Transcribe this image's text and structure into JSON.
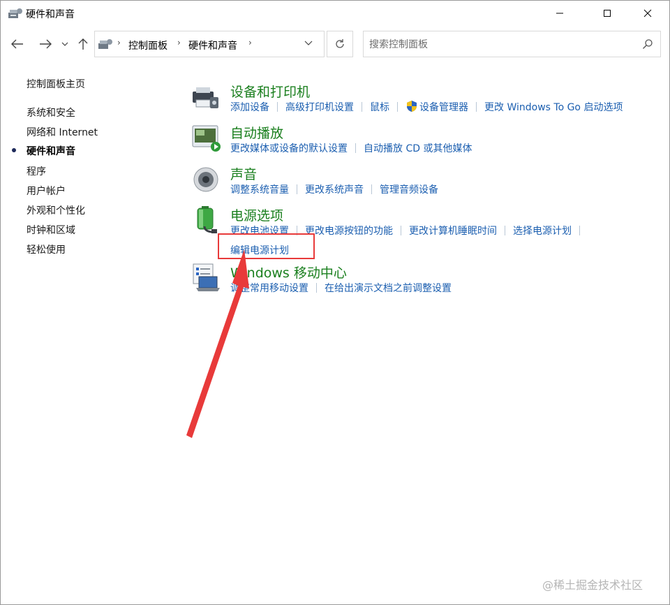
{
  "window": {
    "title": "硬件和声音",
    "buttons": {
      "minimize": "—",
      "maximize": "☐",
      "close": "✕"
    }
  },
  "nav": {
    "back": "←",
    "forward": "→",
    "recent": "⌄",
    "up": "↑",
    "breadcrumb": [
      "控制面板",
      "硬件和声音"
    ],
    "refresh": "↻",
    "search_placeholder": "搜索控制面板"
  },
  "sidebar": {
    "items": [
      {
        "label": "控制面板主页",
        "active": false
      },
      {
        "label": "系统和安全",
        "active": false
      },
      {
        "label": "网络和 Internet",
        "active": false
      },
      {
        "label": "硬件和声音",
        "active": true
      },
      {
        "label": "程序",
        "active": false
      },
      {
        "label": "用户帐户",
        "active": false
      },
      {
        "label": "外观和个性化",
        "active": false
      },
      {
        "label": "时钟和区域",
        "active": false
      },
      {
        "label": "轻松使用",
        "active": false
      }
    ]
  },
  "categories": [
    {
      "title": "设备和打印机",
      "icon": "printer-icon",
      "links": [
        "添加设备",
        "高级打印机设置",
        "鼠标",
        "设备管理器",
        "更改 Windows To Go 启动选项"
      ]
    },
    {
      "title": "自动播放",
      "icon": "autoplay-icon",
      "links": [
        "更改媒体或设备的默认设置",
        "自动播放 CD 或其他媒体"
      ]
    },
    {
      "title": "声音",
      "icon": "speaker-icon",
      "links": [
        "调整系统音量",
        "更改系统声音",
        "管理音频设备"
      ]
    },
    {
      "title": "电源选项",
      "icon": "battery-icon",
      "links": [
        "更改电池设置",
        "更改电源按钮的功能",
        "更改计算机睡眠时间",
        "选择电源计划"
      ],
      "links_second_row": [
        "编辑电源计划"
      ]
    },
    {
      "title": "Windows 移动中心",
      "icon": "mobility-center-icon",
      "links": [
        "调整常用移动设置",
        "在给出演示文档之前调整设置"
      ]
    }
  ],
  "colors": {
    "category_title": "#1a7f1e",
    "link": "#1c5fb0",
    "annotation": "#e83a3a"
  },
  "watermark": "@稀土掘金技术社区"
}
